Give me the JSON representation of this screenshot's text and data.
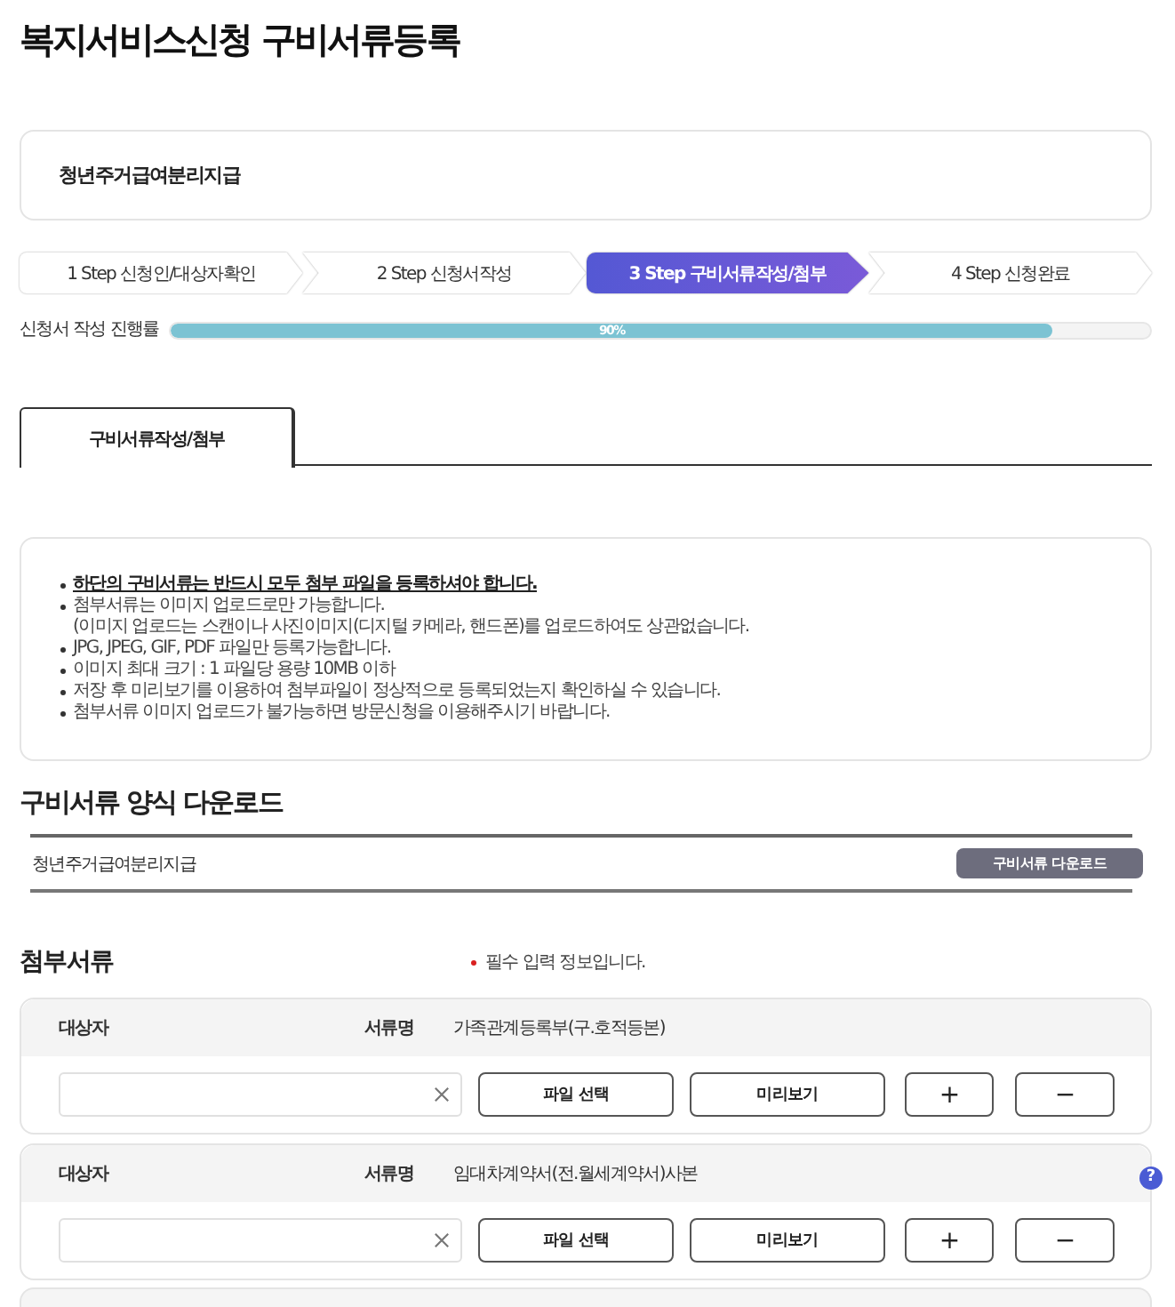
{
  "page_title": "복지서비스신청 구비서류등록",
  "service": {
    "name": "청년주거급여분리지급"
  },
  "steps": [
    {
      "label": "1 Step 신청인/대상자확인",
      "selected": false
    },
    {
      "label": "2 Step 신청서작성",
      "selected": false
    },
    {
      "label": "3 Step 구비서류작성/첨부",
      "selected": true
    },
    {
      "label": "4 Step 신청완료",
      "selected": false
    }
  ],
  "progress": {
    "label": "신청서 작성 진행률",
    "level": 0.9,
    "reading": "90%"
  },
  "tabs": [
    {
      "label": "구비서류작성/첨부",
      "selected": true
    }
  ],
  "notice": {
    "items": [
      {
        "text": "하단의 구비서류는 반드시 모두 첨부 파일을 등록하셔야 합니다.",
        "emphasis": true
      },
      {
        "text": "첨부서류는 이미지 업로드로만 가능합니다.",
        "note": "(이미지 업로드는 스캔이나 사진이미지(디지털 카메라, 핸드폰)를 업로드하여도 상관없습니다.",
        "emphasis": false
      },
      {
        "text": "JPG, JPEG, GIF, PDF 파일만 등록가능합니다.",
        "emphasis": false
      },
      {
        "text": "이미지 최대 크기 : 1 파일당 용량 10MB 이하",
        "emphasis": false
      },
      {
        "text": "저장 후 미리보기를 이용하여 첨부파일이 정상적으로 등록되었는지 확인하실 수 있습니다.",
        "emphasis": false
      },
      {
        "text": "첨부서류 이미지 업로드가 불가능하면 방문신청을 이용해주시기 바랍니다.",
        "emphasis": false
      }
    ]
  },
  "form_download": {
    "title": "구비서류 양식 다운로드",
    "rows": [
      {
        "name": "청년주거급여분리지급",
        "button": "구비서류 다운로드"
      }
    ]
  },
  "attachments": {
    "title": "첨부서류",
    "required_note": "필수 입력 정보입니다.",
    "documents": [
      {
        "subject_label": "대상자",
        "doc_label": "서류명",
        "doc_name": "가족관계등록부(구.호적등본)",
        "select_button": "파일 선택",
        "preview_button": "미리보기",
        "add_button": "+",
        "remove_button": "−"
      },
      {
        "subject_label": "대상자",
        "doc_label": "서류명",
        "doc_name": "임대차계약서(전.월세계약서)사본",
        "help": "?",
        "select_button": "파일 선택",
        "preview_button": "미리보기",
        "add_button": "+",
        "remove_button": "−"
      }
    ]
  }
}
